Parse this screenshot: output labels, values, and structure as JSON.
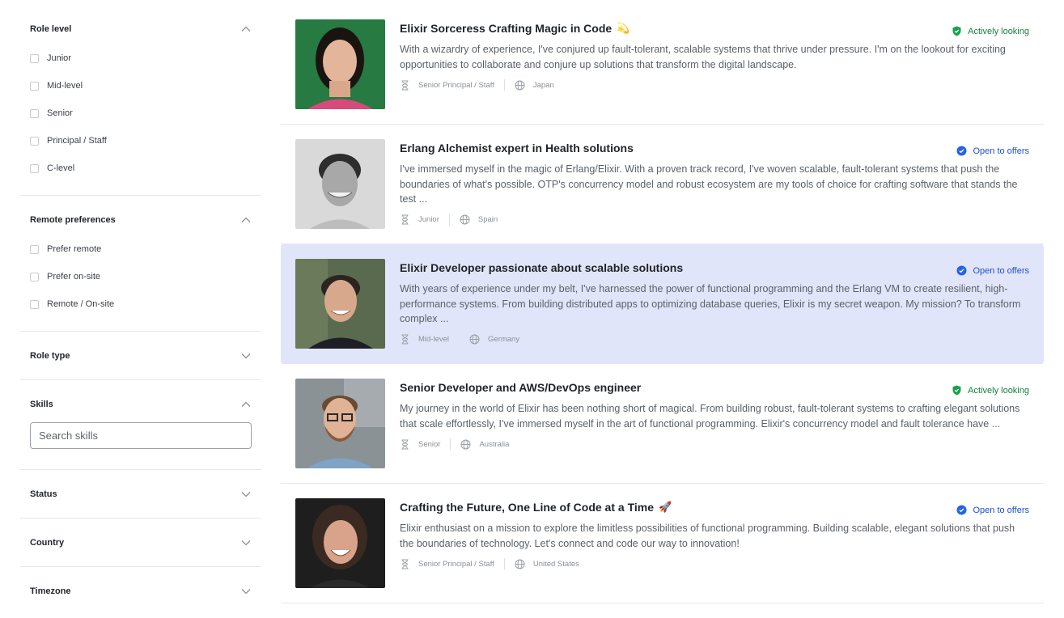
{
  "sidebar": {
    "role_level": {
      "title": "Role level",
      "options": [
        "Junior",
        "Mid-level",
        "Senior",
        "Principal / Staff",
        "C-level"
      ]
    },
    "remote": {
      "title": "Remote preferences",
      "options": [
        "Prefer remote",
        "Prefer on-site",
        "Remote / On-site"
      ]
    },
    "role_type": {
      "title": "Role type"
    },
    "skills": {
      "title": "Skills",
      "placeholder": "Search skills"
    },
    "status": {
      "title": "Status"
    },
    "country": {
      "title": "Country"
    },
    "timezone": {
      "title": "Timezone"
    }
  },
  "candidates": [
    {
      "title": "Elixir Sorceress Crafting Magic in Code",
      "emoji": "💫",
      "description": "With a wizardry of experience, I've conjured up fault-tolerant, scalable systems that thrive under pressure. I'm on the lookout for exciting opportunities to collaborate and conjure up solutions that transform the digital landscape.",
      "levels": "Senior  Principal / Staff",
      "country": "Japan",
      "status": "Actively looking",
      "status_type": "green",
      "status_color": "#16a34a"
    },
    {
      "title": "Erlang Alchemist expert in Health solutions",
      "emoji": "",
      "description": "I've immersed myself in the magic of Erlang/Elixir. With a proven track record, I've woven scalable, fault-tolerant systems that push the boundaries of what's possible. OTP's concurrency model and robust ecosystem are my tools of choice for crafting software that stands the test ...",
      "levels": "Junior",
      "country": "Spain",
      "status": "Open to offers",
      "status_type": "blue",
      "status_color": "#2563eb"
    },
    {
      "title": "Elixir Developer passionate about scalable solutions",
      "emoji": "",
      "description": "With years of experience under my belt, I've harnessed the power of functional programming and the Erlang VM to create resilient, high-performance systems. From building distributed apps to optimizing database queries, Elixir is my secret weapon. My mission? To transform complex ...",
      "levels": "Mid-level",
      "country": "Germany",
      "status": "Open to offers",
      "status_type": "blue",
      "status_color": "#2563eb"
    },
    {
      "title": "Senior Developer and AWS/DevOps engineer",
      "emoji": "",
      "description": "My journey in the world of Elixir has been nothing short of magical. From building robust, fault-tolerant systems to crafting elegant solutions that scale effortlessly, I've immersed myself in the art of functional programming. Elixir's concurrency model and fault tolerance have ...",
      "levels": "Senior",
      "country": "Australia",
      "status": "Actively looking",
      "status_type": "green",
      "status_color": "#16a34a"
    },
    {
      "title": "Crafting the Future, One Line of Code at a Time",
      "emoji": "🚀",
      "description": "Elixir enthusiast on a mission to explore the limitless possibilities of functional programming. Building scalable, elegant solutions that push the boundaries of technology. Let's connect and code our way to innovation!",
      "levels": "Senior  Principal / Staff",
      "country": "United States",
      "status": "Open to offers",
      "status_type": "blue",
      "status_color": "#2563eb"
    }
  ],
  "colors": {
    "highlight_bg": "#e1e5f9",
    "actively_looking": "#16a34a",
    "open_to_offers": "#2563eb"
  }
}
